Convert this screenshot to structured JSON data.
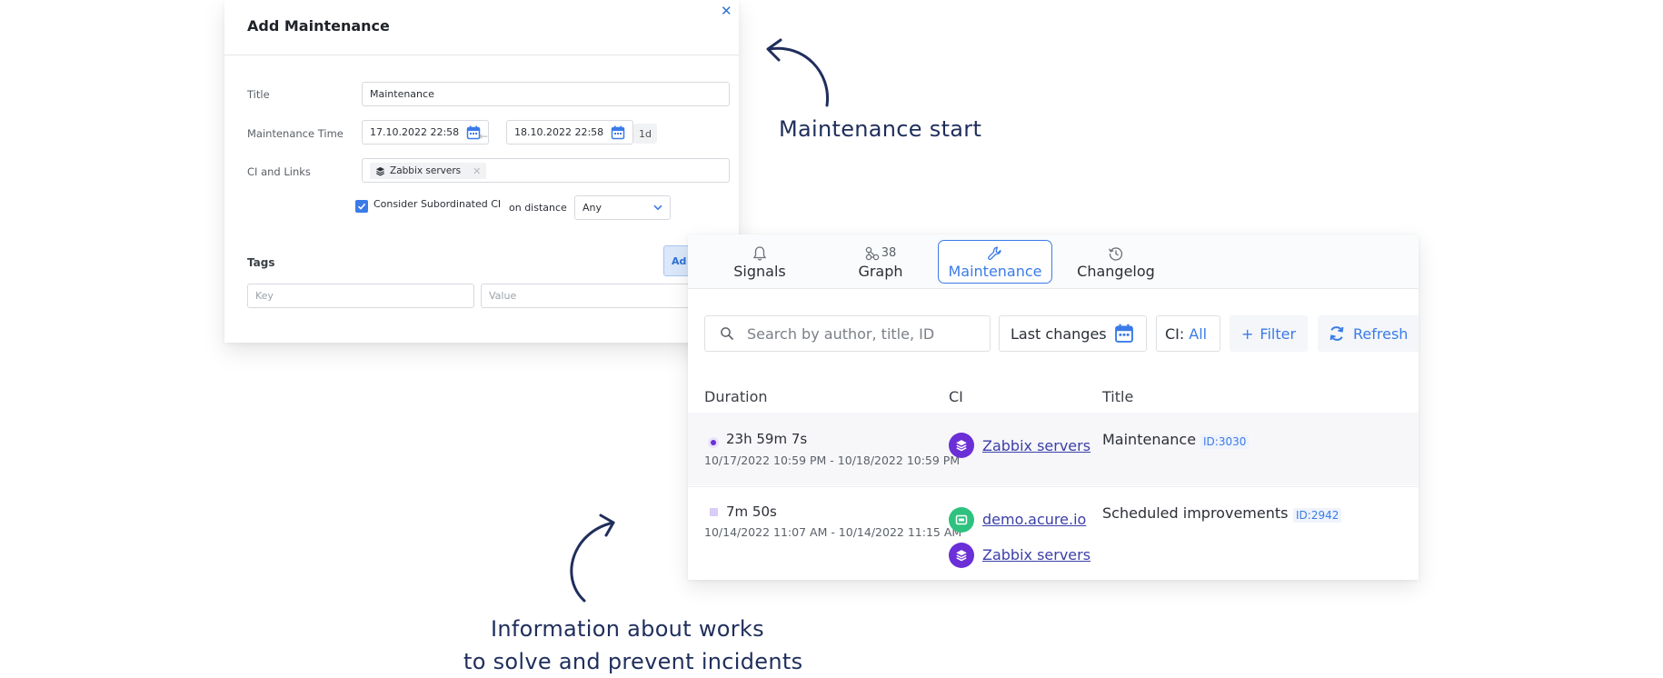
{
  "dialog": {
    "title": "Add Maintenance",
    "close_icon": "close-icon",
    "labels": {
      "title": "Title",
      "time": "Maintenance Time",
      "ci": "CI and Links",
      "tags": "Tags"
    },
    "title_value": "Maintenance",
    "start": "17.10.2022 22:58",
    "end": "18.10.2022 22:58",
    "duration_badge": "1d",
    "ci_chip": "Zabbix servers",
    "consider_sub": "Consider Subordinated CI",
    "on_distance": "on distance",
    "distance_value": "Any",
    "add_button": "Ad",
    "key_placeholder": "Key",
    "value_placeholder": "Value"
  },
  "tabs": [
    {
      "label": "Signals",
      "icon": "bell-icon"
    },
    {
      "label": "Graph",
      "icon": "graph-icon",
      "count": "38"
    },
    {
      "label": "Maintenance",
      "icon": "wrench-icon"
    },
    {
      "label": "Changelog",
      "icon": "history-icon"
    }
  ],
  "toolbar": {
    "search_placeholder": "Search by author, title, ID",
    "last_changes": "Last changes",
    "ci_label": "CI:",
    "ci_value": "All",
    "filter": "Filter",
    "refresh": "Refresh"
  },
  "table": {
    "headers": {
      "duration": "Duration",
      "ci": "CI",
      "title": "Title"
    },
    "rows": [
      {
        "duration": "23h 59m 7s",
        "range": "10/17/2022 10:59 PM - 10/18/2022 10:59 PM",
        "ci": [
          "Zabbix servers"
        ],
        "title": "Maintenance",
        "id": "ID:3030"
      },
      {
        "duration": "7m 50s",
        "range": "10/14/2022 11:07 AM - 10/14/2022 11:15 AM",
        "ci": [
          "demo.acure.io",
          "Zabbix servers"
        ],
        "title": "Scheduled improvements",
        "id": "ID:2942"
      }
    ]
  },
  "annotations": {
    "start": "Maintenance start",
    "info_line1": "Information about works",
    "info_line2": "to solve and prevent incidents"
  },
  "colors": {
    "accent": "#3b7be8",
    "purple": "#6a2fd6",
    "green": "#2ec27e",
    "navy": "#1f2e5c"
  }
}
